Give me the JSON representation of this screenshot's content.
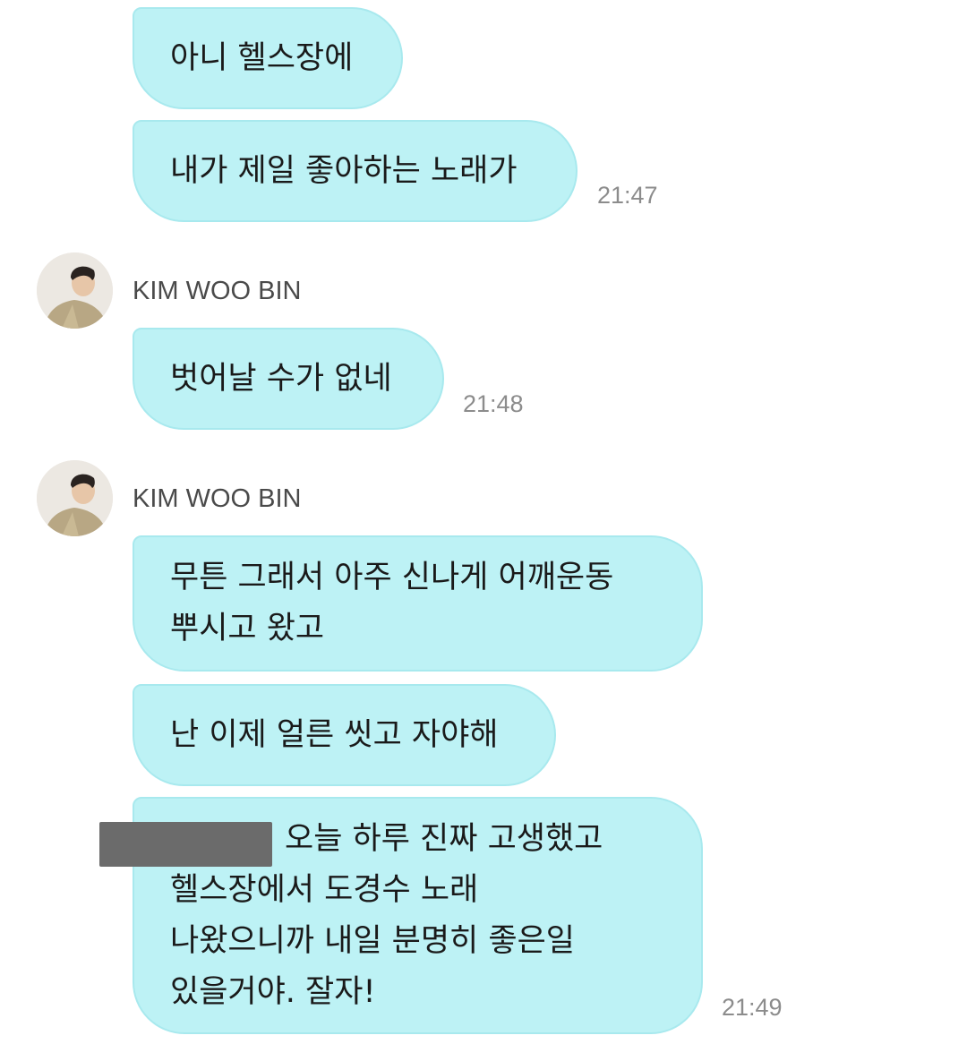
{
  "messages": [
    {
      "text": "아니 헬스장에"
    },
    {
      "text": "내가 제일 좋아하는 노래가",
      "time": "21:47"
    },
    {
      "sender": "KIM WOO BIN",
      "text": "벗어날 수가 없네",
      "time": "21:48"
    },
    {
      "sender": "KIM WOO BIN",
      "lines": [
        "무튼 그래서 아주 신나게 어깨운동",
        "뿌시고 왔고"
      ]
    },
    {
      "text": "난 이제 얼른 씻고 자야해"
    },
    {
      "lines": [
        "오늘 하루 진짜 고생했고",
        "헬스장에서 도경수 노래",
        "나왔으니까 내일 분명히 좋은일",
        "있을거야. 잘자!"
      ],
      "time": "21:49"
    }
  ],
  "colors": {
    "bubble": "#bdf2f5",
    "bubble_border": "#a8e9ee",
    "time": "#8c8c8c",
    "redaction": "#6b6b6b"
  }
}
